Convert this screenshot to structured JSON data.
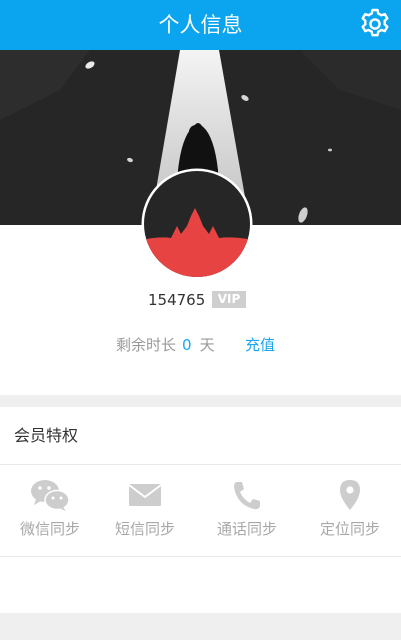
{
  "header": {
    "title": "个人信息",
    "settings_icon": "gear-icon"
  },
  "profile": {
    "user_id": "154765",
    "vip_label": "VIP",
    "remaining_label": "剩余时长",
    "remaining_days": "0",
    "days_unit": "天",
    "recharge_label": "充值"
  },
  "perks": {
    "title": "会员特权",
    "items": [
      {
        "label": "微信同步",
        "icon": "wechat-icon"
      },
      {
        "label": "短信同步",
        "icon": "envelope-icon"
      },
      {
        "label": "通话同步",
        "icon": "phone-icon"
      },
      {
        "label": "定位同步",
        "icon": "location-pin-icon"
      }
    ]
  },
  "colors": {
    "accent": "#0aa4ef",
    "link": "#1ba6ef",
    "banner": "#262626",
    "avatar_red": "#e84343",
    "muted_icon": "#cdcdcd"
  }
}
